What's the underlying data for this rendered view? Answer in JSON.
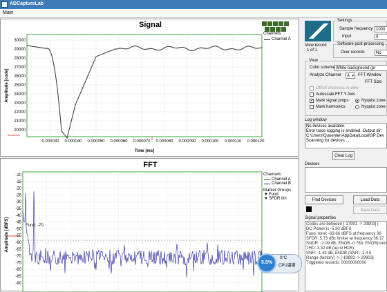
{
  "window": {
    "title": "ADCaptureLab"
  },
  "menu": {
    "main": "Main"
  },
  "signal_panel": {
    "title": "Signal",
    "legend_title": "Channels",
    "legend_item": "Channel A",
    "y_label": "Amplitude [code]",
    "x_label": "Time [ms]",
    "y_ticks": [
      "30000",
      "29000",
      "28000",
      "27000",
      "26000",
      "25000",
      "24000",
      "23000",
      "22000",
      "21000",
      "20000"
    ],
    "x_ticks": [
      "0.000030",
      "0.000040",
      "0.000050",
      "0.000060",
      "0.000070",
      "0.000080",
      "0.000090",
      "0.000100",
      "0.000110",
      "0.000120"
    ],
    "trace_color": "#404040"
  },
  "fft_panel": {
    "title": "FFT",
    "y_label": "Amplitude [dBFS]",
    "annotation": "Fund: -70",
    "legend_channels_title": "Channels",
    "legend_channels": [
      "Channel A",
      "Channel B"
    ],
    "marker_groups_title": "Marker Groups",
    "marker_groups": [
      "Fund",
      "SFDR lim"
    ],
    "y_ticks": [
      "-10",
      "-15",
      "-20",
      "-25",
      "-30",
      "-35",
      "-40",
      "-45",
      "-50",
      "-55",
      "-60",
      "-65",
      "-70",
      "-75",
      "-80",
      "-85",
      "-90"
    ],
    "trace_color": "#1a1a99"
  },
  "status_overlay": {
    "value": "5.5%",
    "line1": "0°C",
    "line2": "CPU温度"
  },
  "right_panel": {
    "view_record_label": "View record",
    "view_record_value": "1 of 1",
    "settings_title": "Settings",
    "sample_frequency_label": "Sample frequency",
    "sample_frequency_value": "1000",
    "input_label": "Input",
    "input_value": "0",
    "post_processing_title": "Software post-processing",
    "over_records_label": "Over records",
    "over_records_value": "No",
    "view_title": "View",
    "color_scheme_label": "Color scheme",
    "color_scheme_value": "White background (pr",
    "analyze_channel_label": "Analyze Channel",
    "analyze_channel_value": "A",
    "fft_window_label": "FFT Window",
    "fft_size_label": "FFT Size",
    "offset_channels_label": "Offset channels in view",
    "autoscale_label": "Autoscale FFT Y Axis",
    "mark_signal_props_label": "Mark signal props",
    "mark_harmonics_label": "Mark harmonics",
    "nyquist_zone1_label": "Nyquist zone",
    "nyquist_zone2_label": "Nyquist zone",
    "log_window_title": "Log window",
    "log_lines": [
      "No devices available.",
      "Error trace logging is enabled. Output dir:",
      "C:\\Users\\Quuenter\\AppData\\Local\\SP Dev",
      "Scanning for devices ..."
    ],
    "clear_log_label": "Clear Log",
    "devices_title": "Devices",
    "find_devices_label": "Find Devices",
    "load_data_label": "Load Data",
    "save_data_label": "Save Data",
    "signal_properties_title": "Signal properties",
    "signal_properties_lines": [
      "Codes are between [-17991 -> 29903] (",
      "DC Power is -5.30 dBFS",
      "Fund. tone: -69.66 dBFS at frequency 36",
      "SFDR: 5.73 dBc limiter at frequency 36.17",
      "SNDR: -2.09 dB, ENOB -0.76b, ENOB(norm",
      "THD: 3.32 dB (up to HD5)",
      "SNR: -1.43 dB, ENOB (SNR) -1.4 b",
      "Range (factory) -> [-19993 -> 29903]",
      "Triggered records: 00000000000"
    ]
  }
}
